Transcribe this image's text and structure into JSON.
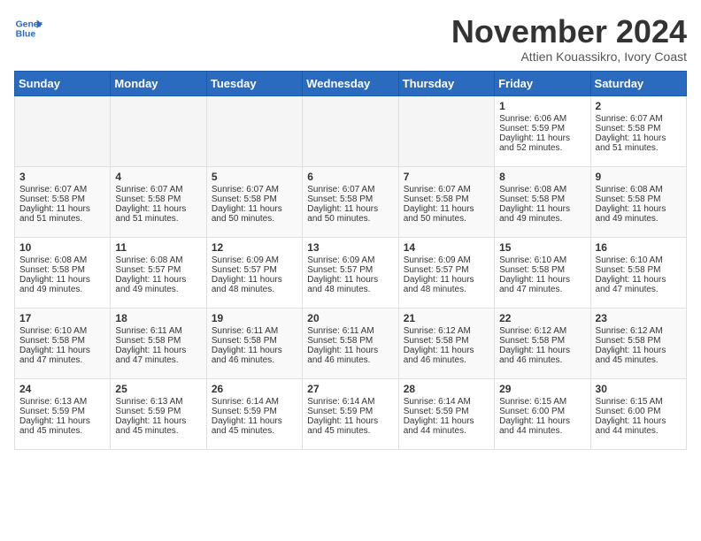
{
  "header": {
    "logo_line1": "General",
    "logo_line2": "Blue",
    "title": "November 2024",
    "subtitle": "Attien Kouassikro, Ivory Coast"
  },
  "days_of_week": [
    "Sunday",
    "Monday",
    "Tuesday",
    "Wednesday",
    "Thursday",
    "Friday",
    "Saturday"
  ],
  "weeks": [
    [
      {
        "day": "",
        "empty": true
      },
      {
        "day": "",
        "empty": true
      },
      {
        "day": "",
        "empty": true
      },
      {
        "day": "",
        "empty": true
      },
      {
        "day": "",
        "empty": true
      },
      {
        "day": "1",
        "sunrise": "6:06 AM",
        "sunset": "5:59 PM",
        "daylight": "11 hours and 52 minutes."
      },
      {
        "day": "2",
        "sunrise": "6:07 AM",
        "sunset": "5:58 PM",
        "daylight": "11 hours and 51 minutes."
      }
    ],
    [
      {
        "day": "3",
        "sunrise": "6:07 AM",
        "sunset": "5:58 PM",
        "daylight": "11 hours and 51 minutes."
      },
      {
        "day": "4",
        "sunrise": "6:07 AM",
        "sunset": "5:58 PM",
        "daylight": "11 hours and 51 minutes."
      },
      {
        "day": "5",
        "sunrise": "6:07 AM",
        "sunset": "5:58 PM",
        "daylight": "11 hours and 50 minutes."
      },
      {
        "day": "6",
        "sunrise": "6:07 AM",
        "sunset": "5:58 PM",
        "daylight": "11 hours and 50 minutes."
      },
      {
        "day": "7",
        "sunrise": "6:07 AM",
        "sunset": "5:58 PM",
        "daylight": "11 hours and 50 minutes."
      },
      {
        "day": "8",
        "sunrise": "6:08 AM",
        "sunset": "5:58 PM",
        "daylight": "11 hours and 49 minutes."
      },
      {
        "day": "9",
        "sunrise": "6:08 AM",
        "sunset": "5:58 PM",
        "daylight": "11 hours and 49 minutes."
      }
    ],
    [
      {
        "day": "10",
        "sunrise": "6:08 AM",
        "sunset": "5:58 PM",
        "daylight": "11 hours and 49 minutes."
      },
      {
        "day": "11",
        "sunrise": "6:08 AM",
        "sunset": "5:57 PM",
        "daylight": "11 hours and 49 minutes."
      },
      {
        "day": "12",
        "sunrise": "6:09 AM",
        "sunset": "5:57 PM",
        "daylight": "11 hours and 48 minutes."
      },
      {
        "day": "13",
        "sunrise": "6:09 AM",
        "sunset": "5:57 PM",
        "daylight": "11 hours and 48 minutes."
      },
      {
        "day": "14",
        "sunrise": "6:09 AM",
        "sunset": "5:57 PM",
        "daylight": "11 hours and 48 minutes."
      },
      {
        "day": "15",
        "sunrise": "6:10 AM",
        "sunset": "5:58 PM",
        "daylight": "11 hours and 47 minutes."
      },
      {
        "day": "16",
        "sunrise": "6:10 AM",
        "sunset": "5:58 PM",
        "daylight": "11 hours and 47 minutes."
      }
    ],
    [
      {
        "day": "17",
        "sunrise": "6:10 AM",
        "sunset": "5:58 PM",
        "daylight": "11 hours and 47 minutes."
      },
      {
        "day": "18",
        "sunrise": "6:11 AM",
        "sunset": "5:58 PM",
        "daylight": "11 hours and 47 minutes."
      },
      {
        "day": "19",
        "sunrise": "6:11 AM",
        "sunset": "5:58 PM",
        "daylight": "11 hours and 46 minutes."
      },
      {
        "day": "20",
        "sunrise": "6:11 AM",
        "sunset": "5:58 PM",
        "daylight": "11 hours and 46 minutes."
      },
      {
        "day": "21",
        "sunrise": "6:12 AM",
        "sunset": "5:58 PM",
        "daylight": "11 hours and 46 minutes."
      },
      {
        "day": "22",
        "sunrise": "6:12 AM",
        "sunset": "5:58 PM",
        "daylight": "11 hours and 46 minutes."
      },
      {
        "day": "23",
        "sunrise": "6:12 AM",
        "sunset": "5:58 PM",
        "daylight": "11 hours and 45 minutes."
      }
    ],
    [
      {
        "day": "24",
        "sunrise": "6:13 AM",
        "sunset": "5:59 PM",
        "daylight": "11 hours and 45 minutes."
      },
      {
        "day": "25",
        "sunrise": "6:13 AM",
        "sunset": "5:59 PM",
        "daylight": "11 hours and 45 minutes."
      },
      {
        "day": "26",
        "sunrise": "6:14 AM",
        "sunset": "5:59 PM",
        "daylight": "11 hours and 45 minutes."
      },
      {
        "day": "27",
        "sunrise": "6:14 AM",
        "sunset": "5:59 PM",
        "daylight": "11 hours and 45 minutes."
      },
      {
        "day": "28",
        "sunrise": "6:14 AM",
        "sunset": "5:59 PM",
        "daylight": "11 hours and 44 minutes."
      },
      {
        "day": "29",
        "sunrise": "6:15 AM",
        "sunset": "6:00 PM",
        "daylight": "11 hours and 44 minutes."
      },
      {
        "day": "30",
        "sunrise": "6:15 AM",
        "sunset": "6:00 PM",
        "daylight": "11 hours and 44 minutes."
      }
    ]
  ]
}
